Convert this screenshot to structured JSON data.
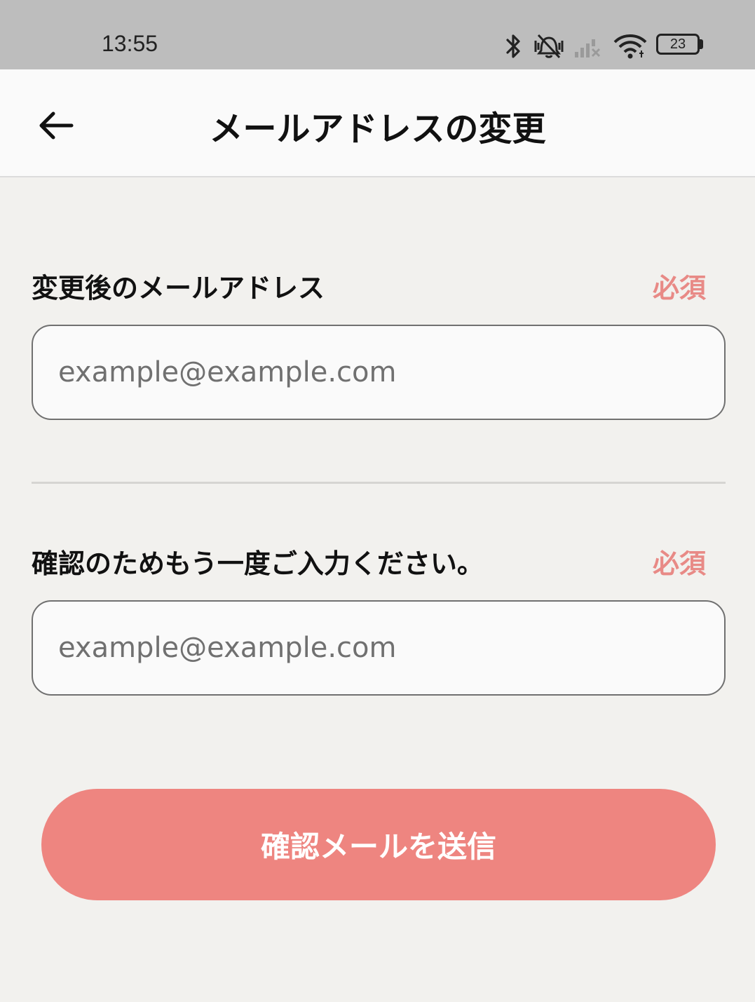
{
  "status_bar": {
    "time": "13:55",
    "battery_level": "23",
    "icons": [
      "bluetooth-icon",
      "vibrate-off-icon",
      "signal-off-icon",
      "wifi-icon",
      "battery-icon"
    ]
  },
  "app_bar": {
    "back_icon": "arrow-left-icon",
    "title": "メールアドレスの変更"
  },
  "form": {
    "new_email": {
      "label": "変更後のメールアドレス",
      "required_badge": "必須",
      "value": "",
      "placeholder": "example@example.com"
    },
    "confirm_email": {
      "label": "確認のためもう一度ご入力ください。",
      "required_badge": "必須",
      "value": "",
      "placeholder": "example@example.com"
    },
    "submit_label": "確認メールを送信"
  },
  "colors": {
    "accent": "#ee8580",
    "required": "#e88a86",
    "background": "#f2f1ee",
    "status_bar": "#bdbdbd"
  }
}
